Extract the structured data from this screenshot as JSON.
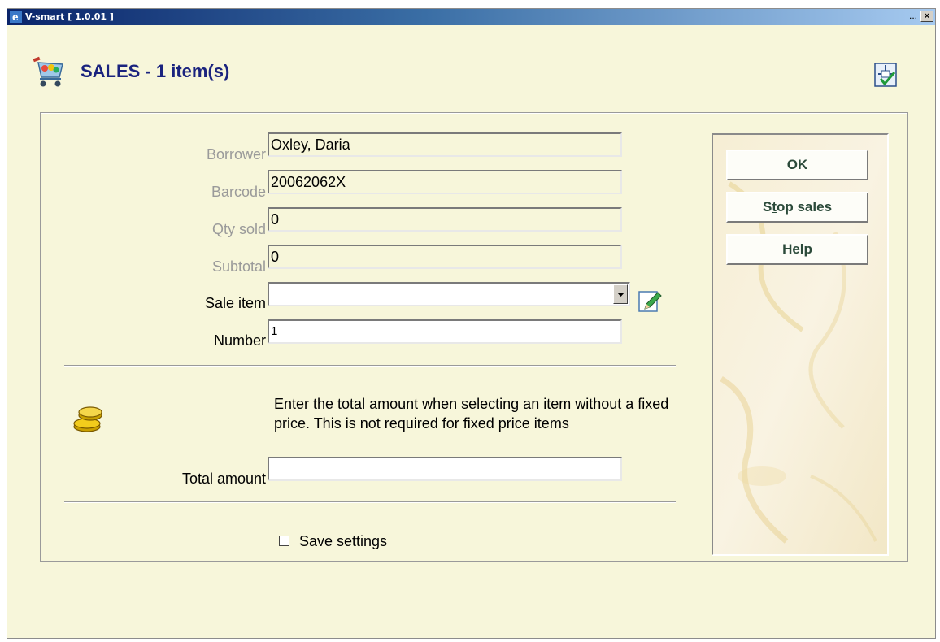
{
  "window": {
    "title": "V-smart [ 1.0.01 ]",
    "title_dots": "...",
    "close_glyph": "×"
  },
  "page": {
    "title": "SALES - 1 item(s)"
  },
  "form": {
    "borrower": {
      "label": "Borrower",
      "value": "Oxley, Daria"
    },
    "barcode": {
      "label": "Barcode",
      "value": "20062062X"
    },
    "qty_sold": {
      "label": "Qty sold",
      "value": "0"
    },
    "subtotal": {
      "label": "Subtotal",
      "value": "0"
    },
    "sale_item": {
      "label": "Sale item",
      "value": ""
    },
    "number": {
      "label": "Number",
      "value": "1"
    },
    "info_text": "Enter the total amount when selecting an item without a fixed price. This is not required for fixed price items",
    "total_amount": {
      "label": "Total amount",
      "value": ""
    },
    "save_settings": {
      "label": "Save settings",
      "checked": false
    }
  },
  "side_buttons": {
    "ok": "OK",
    "stop_sales_prefix": "S",
    "stop_sales_underline": "t",
    "stop_sales_suffix": "op sales",
    "help": "Help"
  },
  "icons": {
    "header": "shopping-cart-icon",
    "confirm": "confirm-checkmark-icon",
    "edit": "pencil-icon",
    "coins": "coins-icon"
  }
}
